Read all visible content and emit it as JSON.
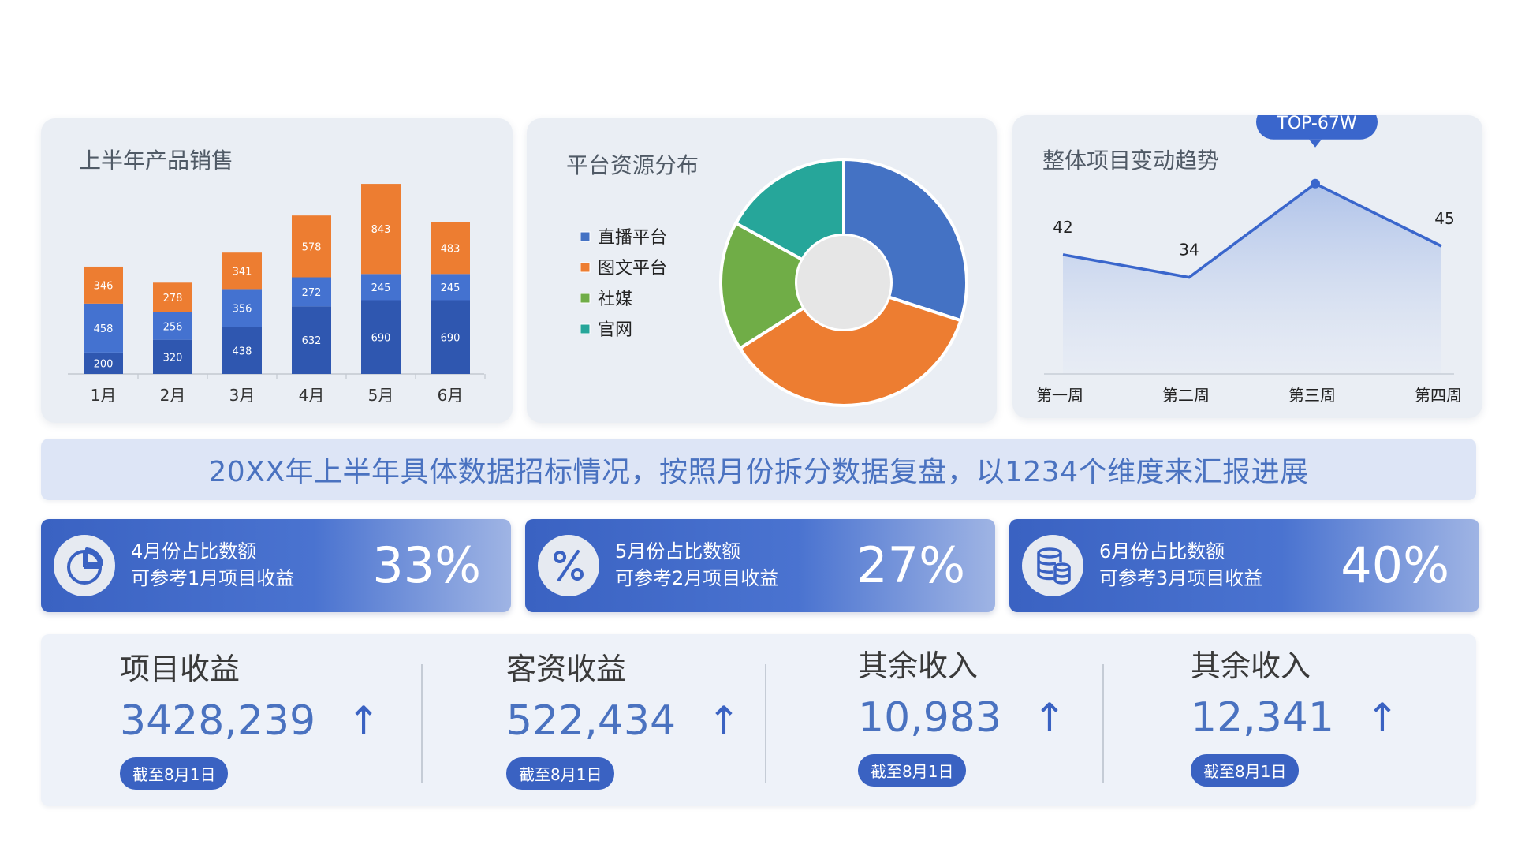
{
  "cards": {
    "sales_title": "上半年产品销售",
    "platform_title": "平台资源分布",
    "trend_title": "整体项目变动趋势"
  },
  "chart_data": [
    {
      "type": "bar",
      "stacked": true,
      "title": "上半年产品销售",
      "categories": [
        "1月",
        "2月",
        "3月",
        "4月",
        "5月",
        "6月"
      ],
      "series": [
        {
          "values": [
            200,
            320,
            438,
            632,
            690,
            690
          ],
          "color": "#2f57b0"
        },
        {
          "values": [
            458,
            256,
            356,
            272,
            245,
            245
          ],
          "color": "#4472d0"
        },
        {
          "values": [
            346,
            278,
            341,
            578,
            843,
            483
          ],
          "color": "#ed7d31"
        }
      ],
      "legend": false,
      "grid": false
    },
    {
      "type": "pie",
      "donut": true,
      "title": "平台资源分布",
      "labels": [
        "直播平台",
        "图文平台",
        "社媒",
        "官网"
      ],
      "values": [
        30,
        36,
        17,
        17
      ],
      "colors": [
        "#4472c4",
        "#ed7d31",
        "#70ad47",
        "#26a69a"
      ],
      "legend": "left"
    },
    {
      "type": "area",
      "title": "整体项目变动趋势",
      "categories": [
        "第一周",
        "第二周",
        "第三周",
        "第四周"
      ],
      "values": [
        42,
        34,
        67,
        45
      ],
      "data_labels": [
        "42",
        "34",
        "",
        "45"
      ],
      "callout": {
        "index": 2,
        "text": "TOP-67W"
      },
      "ylim": [
        0,
        80
      ],
      "color": "#3a66cc",
      "grid": false
    }
  ],
  "banner": {
    "text": "20XX年上半年具体数据招标情况，按照月份拆分数据复盘，以1234个维度来汇报进展"
  },
  "kpis": [
    {
      "icon": "pie-chart-icon",
      "line1": "4月份占比数额",
      "line2": "可参考1月项目收益",
      "percent": "33%"
    },
    {
      "icon": "percent-icon",
      "line1": "5月份占比数额",
      "line2": "可参考2月项目收益",
      "percent": "27%"
    },
    {
      "icon": "database-icon",
      "line1": "6月份占比数额",
      "line2": "可参考3月项目收益",
      "percent": "40%"
    }
  ],
  "metrics": [
    {
      "label": "项目收益",
      "value": "3428,239",
      "arrow": "↑",
      "badge": "截至8月1日"
    },
    {
      "label": "客资收益",
      "value": "522,434",
      "arrow": "↑",
      "badge": "截至8月1日"
    },
    {
      "label": "其余收入",
      "value": "10,983",
      "arrow": "↑",
      "badge": "截至8月1日"
    },
    {
      "label": "其余收入",
      "value": "12,341",
      "arrow": "↑",
      "badge": "截至8月1日"
    }
  ]
}
